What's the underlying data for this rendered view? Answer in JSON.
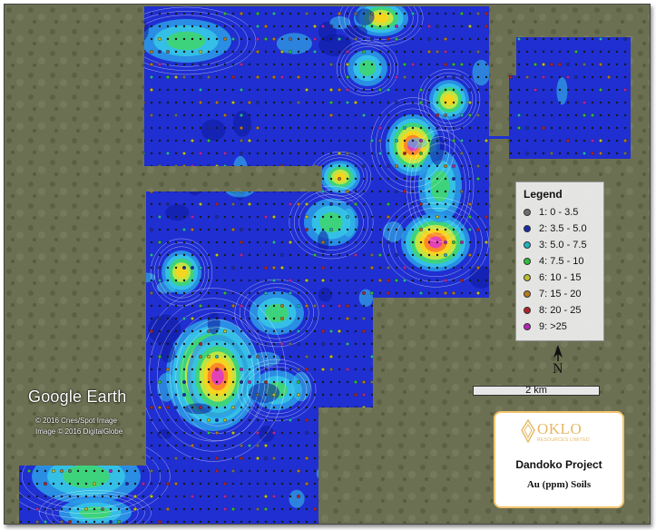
{
  "map": {
    "provider": "Google Earth",
    "copyright_lines": [
      "© 2016 Cnes/Spot Image",
      "Image © 2016 DigitalGlobe"
    ],
    "colors": {
      "background": "#6a6e52",
      "low": "#1b2ed6",
      "high": "#e035d0",
      "mid": "#36c8e8",
      "warm": "#ffd21a"
    }
  },
  "legend": {
    "title": "Legend",
    "items": [
      {
        "label": "1: 0 - 3.5",
        "color": "#6f6f6f"
      },
      {
        "label": "2: 3.5 - 5.0",
        "color": "#1a2aa8"
      },
      {
        "label": "3: 5.0 - 7.5",
        "color": "#1fb3c2"
      },
      {
        "label": "4: 7.5 - 10",
        "color": "#2fbf3a"
      },
      {
        "label": "6: 10 - 15",
        "color": "#bdbf2a"
      },
      {
        "label": "7: 15 - 20",
        "color": "#b87a1e"
      },
      {
        "label": "8: 20 - 25",
        "color": "#b0222a"
      },
      {
        "label": "9: >25",
        "color": "#b324b3"
      }
    ]
  },
  "north_arrow": {
    "letter": "N",
    "icon": "north-arrow-icon"
  },
  "scale_bar": {
    "label": "2 km"
  },
  "title_box": {
    "company": "OKLO",
    "company_sub": "RESOURCES LIMITED",
    "project": "Dandoko Project",
    "subtitle": "Au (ppm) Soils",
    "accent": "#e7b863"
  }
}
